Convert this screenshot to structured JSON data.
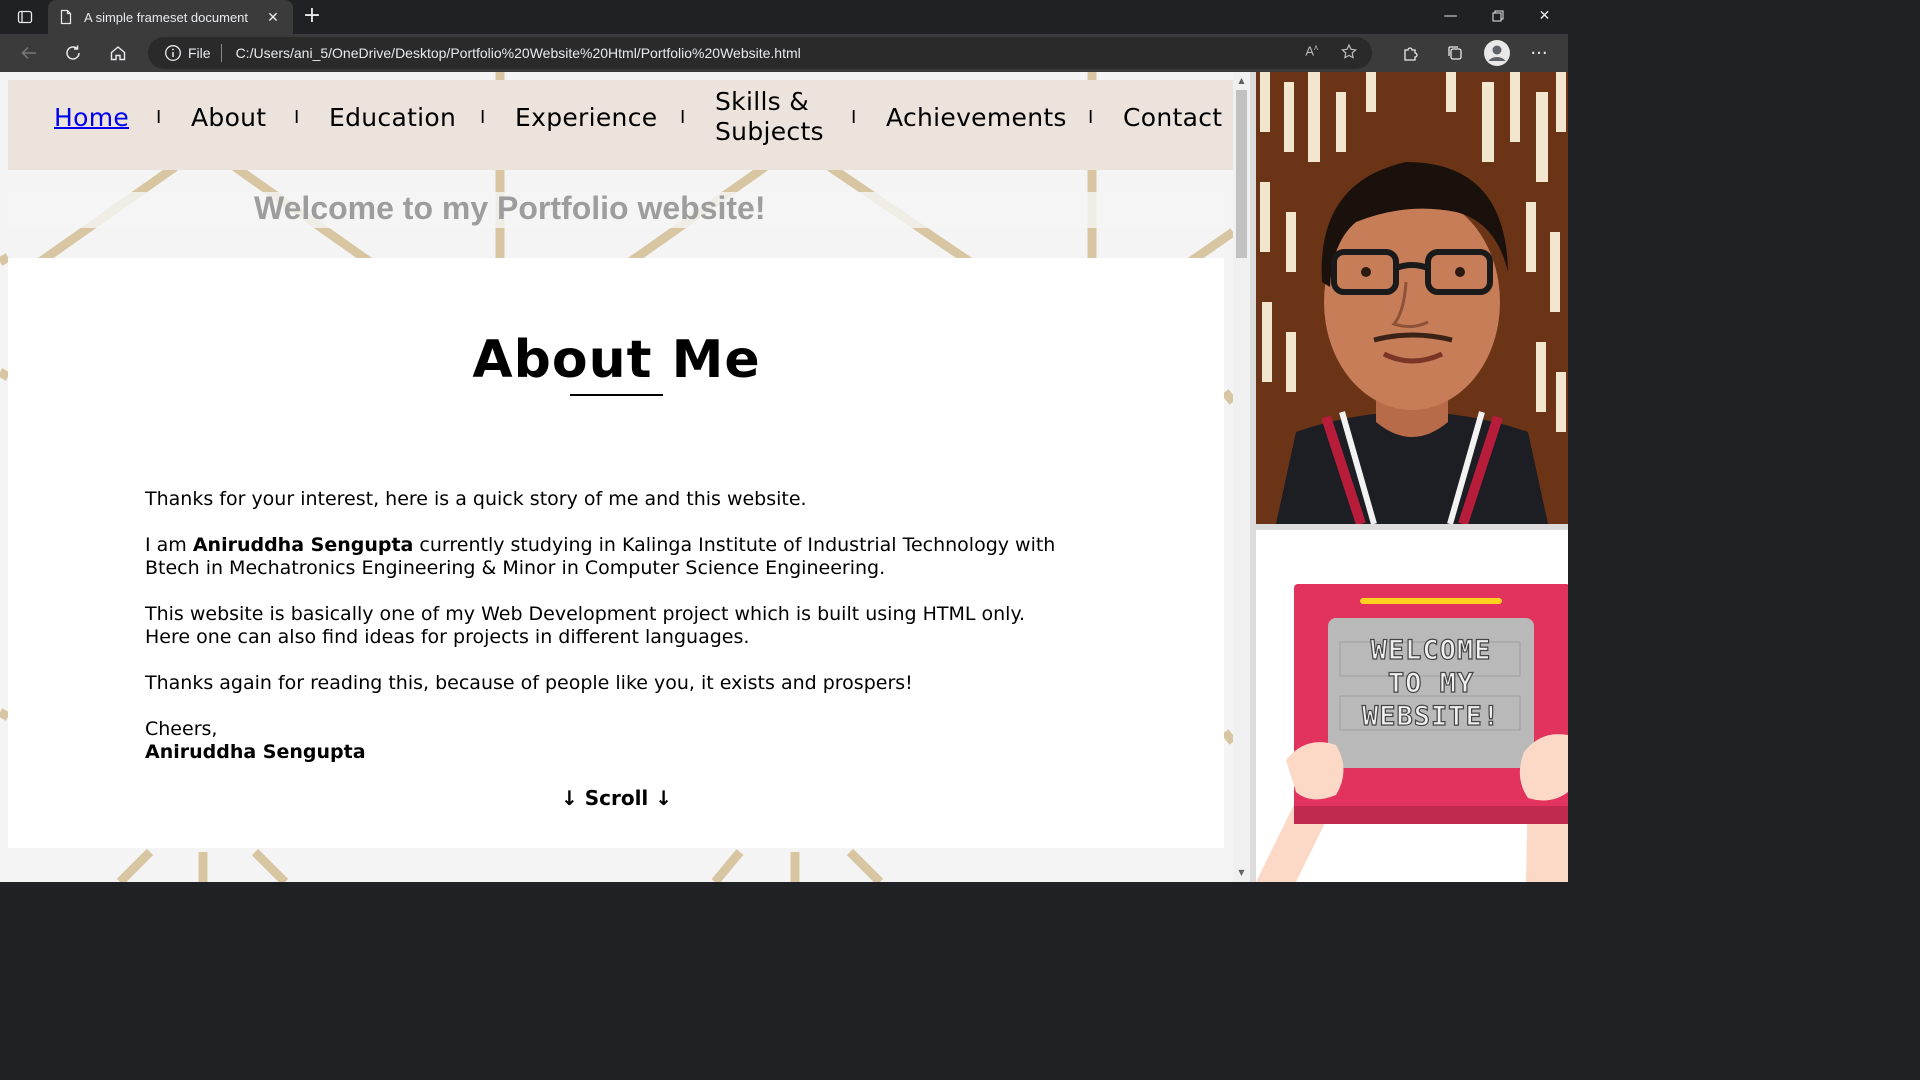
{
  "browser": {
    "tab_title": "A simple frameset document",
    "address_scheme": "File",
    "address_url": "C:/Users/ani_5/OneDrive/Desktop/Portfolio%20Website%20Html/Portfolio%20Website.html"
  },
  "menu": {
    "items": [
      {
        "label": "Home",
        "active": true
      },
      {
        "label": "About"
      },
      {
        "label": "Education"
      },
      {
        "label": "Experience"
      },
      {
        "label_line1": "Skills &",
        "label_line2": "Subjects"
      },
      {
        "label": "Achievements"
      },
      {
        "label": "Contact"
      }
    ],
    "separator": "I"
  },
  "banner": {
    "welcome_text": "Welcome to my Portfolio website!"
  },
  "about": {
    "title": "About Me",
    "intro": "Thanks for your interest, here is a quick story of me and this website.",
    "p2_prefix": "I am ",
    "name": "Aniruddha Sengupta",
    "p2_suffix": " currently studying in Kalinga Institute of Industrial Technology with Btech in Mechatronics Engineering & Minor in Computer Science Engineering.",
    "p3": "This website is basically one of my Web Development project which is built using HTML only. Here one can also find ideas for projects in different languages.",
    "p4": "Thanks again for reading this, because of people like you, it exists and prospers!",
    "signoff": "Cheers,",
    "signature": "Aniruddha Sengupta",
    "scroll_label": "↓ Scroll ↓"
  },
  "side_panel": {
    "sign_line1": "WELCOME",
    "sign_line2": "TO MY",
    "sign_line3": "WEBSITE!"
  },
  "colors": {
    "menu_bg": "#ece3dd",
    "pattern_line": "#d8c6a2",
    "sign_frame": "#e2335e",
    "sign_screen": "#b9b9b9",
    "link": "#0000ee"
  }
}
